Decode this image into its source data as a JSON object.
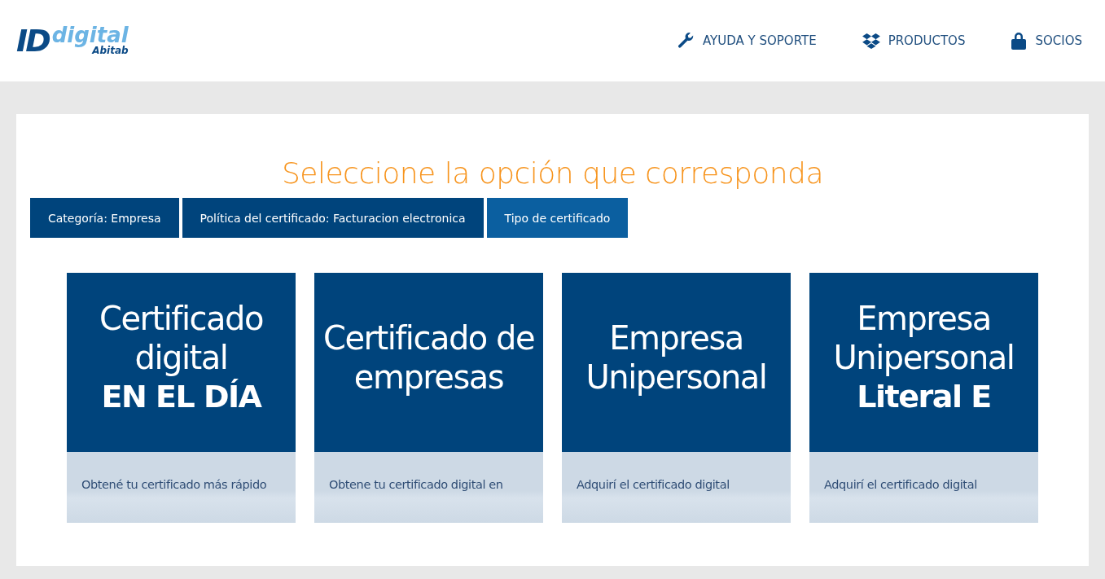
{
  "header": {
    "logo": {
      "mark": "ID",
      "word": "digital",
      "brand": "Abitab"
    },
    "nav": [
      {
        "kind": "wrench",
        "label": "AYUDA Y SOPORTE"
      },
      {
        "kind": "box",
        "label": "PRODUCTOS"
      },
      {
        "kind": "lock",
        "label": "SOCIOS"
      }
    ]
  },
  "heading": "Seleccione la opción que corresponda",
  "steps": [
    {
      "label": "Categoría: Empresa",
      "selected": false
    },
    {
      "label": "Política del certificado: Facturacion electronica",
      "selected": false
    },
    {
      "label": "Tipo de certificado",
      "selected": true
    }
  ],
  "cards": [
    {
      "title_lines": [
        {
          "text": "Certificado",
          "bold": false
        },
        {
          "text": "digital",
          "bold": false
        },
        {
          "text": "EN EL DÍA",
          "bold": true
        }
      ],
      "description": "Obtené tu certificado más rápido"
    },
    {
      "title_lines": [
        {
          "text": "Certificado de",
          "bold": false
        },
        {
          "text": "empresas",
          "bold": false
        }
      ],
      "description": "Obtene tu certificado digital en"
    },
    {
      "title_lines": [
        {
          "text": "Empresa",
          "bold": false
        },
        {
          "text": "Unipersonal",
          "bold": false
        }
      ],
      "description": "Adquirí el certificado digital"
    },
    {
      "title_lines": [
        {
          "text": "Empresa",
          "bold": false
        },
        {
          "text": "Unipersonal",
          "bold": false
        },
        {
          "text": "Literal E",
          "bold": true
        }
      ],
      "description": "Adquirí el certificado digital"
    }
  ]
}
